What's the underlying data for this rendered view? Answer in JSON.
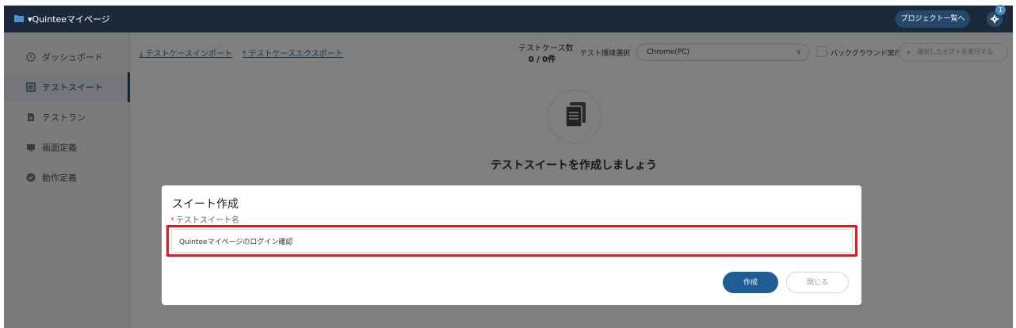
{
  "header": {
    "project_title": "▾Quinteeマイページ",
    "project_list_label": "プロジェクト一覧へ",
    "notification_count": "1"
  },
  "sidebar": {
    "items": [
      {
        "label": "ダッシュボード",
        "icon": "clock-icon"
      },
      {
        "label": "テストスイート",
        "icon": "list-icon",
        "active": true
      },
      {
        "label": "テストラン",
        "icon": "document-icon"
      },
      {
        "label": "画面定義",
        "icon": "monitor-icon"
      },
      {
        "label": "動作定義",
        "icon": "check-circle-icon"
      }
    ]
  },
  "toolbar": {
    "import_label": "⤓ テストケースインポート",
    "export_label": "⤒ テストケースエクスポート",
    "count_label": "テストケース数",
    "count_value": "0 / 0件",
    "env_label": "テスト環境選択",
    "env_value": "Chrome(PC)",
    "background_label": "バックグラウンド実行",
    "run_label": "選択したテストを実行する"
  },
  "empty_state": {
    "title": "テストスイートを作成しましょう"
  },
  "modal": {
    "title": "スイート作成",
    "field_label": "テストスイート名",
    "field_value": "Quinteeマイページのログイン確認",
    "create_label": "作成",
    "close_label": "閉じる"
  },
  "colors": {
    "header_bg": "#1b2a3a",
    "primary": "#1f5d97",
    "highlight": "#e3161d"
  }
}
